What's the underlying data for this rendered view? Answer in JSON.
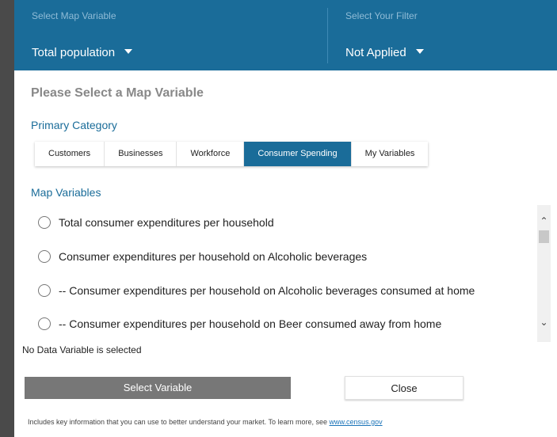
{
  "header": {
    "map_variable_label": "Select Map Variable",
    "map_variable_value": "Total population",
    "filter_label": "Select Your Filter",
    "filter_value": "Not Applied"
  },
  "panel": {
    "heading": "Please Select a Map Variable",
    "primary_category_title": "Primary Category",
    "tabs": [
      {
        "label": "Customers",
        "active": false
      },
      {
        "label": "Businesses",
        "active": false
      },
      {
        "label": "Workforce",
        "active": false
      },
      {
        "label": "Consumer Spending",
        "active": true
      },
      {
        "label": "My Variables",
        "active": false
      }
    ],
    "map_variables_title": "Map Variables",
    "variables": [
      {
        "label": "Total consumer expenditures per household",
        "selected": false
      },
      {
        "label": "Consumer expenditures per household on Alcoholic beverages",
        "selected": false
      },
      {
        "label": "-- Consumer expenditures per household on Alcoholic beverages consumed at home",
        "selected": false
      },
      {
        "label": "-- Consumer expenditures per household on Beer consumed away from home",
        "selected": false
      }
    ],
    "status": "No Data Variable is selected",
    "select_button": "Select Variable",
    "close_button": "Close",
    "footer_text": "Includes key information that you can use to better understand your market. To learn more, see ",
    "footer_link": "www.census.gov"
  },
  "icons": {
    "dropdown": "caret-down-icon",
    "scroll_up": "chevron-up-icon",
    "scroll_down": "chevron-down-icon",
    "radio": "radio-button-icon"
  },
  "colors": {
    "header_bg": "#1a6c99",
    "active_tab": "#1a6c99",
    "primary_button": "#777777",
    "link": "#1a73b8"
  }
}
